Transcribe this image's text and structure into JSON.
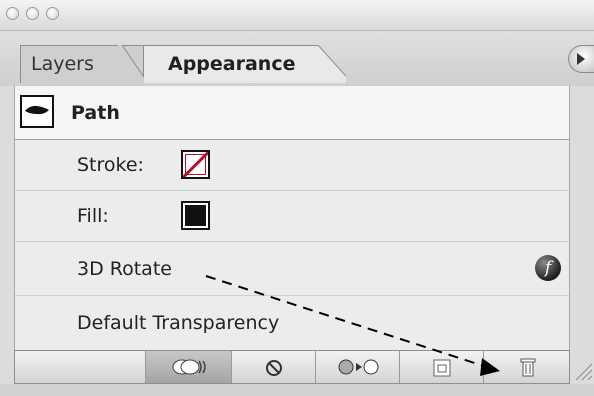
{
  "window": {
    "traffic_lights": [
      "close",
      "minimize",
      "zoom"
    ]
  },
  "tabs": [
    {
      "label": "Layers",
      "active": false
    },
    {
      "label": "Appearance",
      "active": true
    }
  ],
  "header": {
    "flyout_menu_icon": "triangle-right-icon"
  },
  "appearance": {
    "object": {
      "label": "Path",
      "icon": "path-thumbnail-icon"
    },
    "rows": [
      {
        "label": "Stroke:",
        "swatch": "none-stroke",
        "swatch_color": "#b0102c"
      },
      {
        "label": "Fill:",
        "swatch": "black-fill",
        "swatch_color": "#111111"
      },
      {
        "label": "3D Rotate",
        "icon": "fx-icon"
      },
      {
        "label": "Default Transparency"
      }
    ]
  },
  "toolbar": {
    "buttons": [
      {
        "name": "new-art-maintain-appearance",
        "icon": "toggle-pills-icon",
        "pressed": true
      },
      {
        "name": "clear-appearance",
        "icon": "no-circle-icon"
      },
      {
        "name": "reduce-to-basic-appearance",
        "icon": "reduce-basic-icon"
      },
      {
        "name": "duplicate-selected-item",
        "icon": "duplicate-page-icon"
      },
      {
        "name": "delete-selected-item",
        "icon": "trash-icon"
      }
    ]
  },
  "annotation": {
    "type": "dashed-arrow",
    "from": "3D Rotate",
    "to": "delete-selected-item"
  }
}
